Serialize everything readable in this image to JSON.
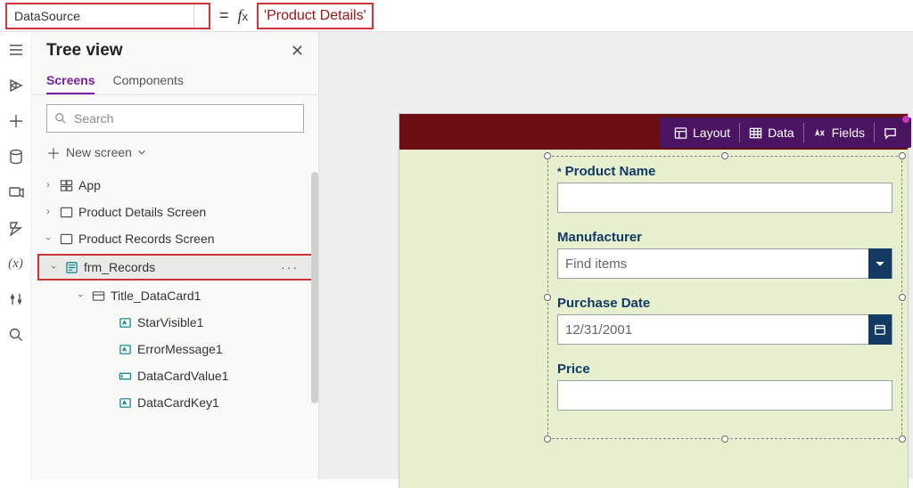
{
  "formula": {
    "property": "DataSource",
    "expression": "'Product Details'"
  },
  "treeview": {
    "title": "Tree view",
    "tabs": {
      "screens": "Screens",
      "components": "Components"
    },
    "search_placeholder": "Search",
    "new_screen": "New screen",
    "items": {
      "app": "App",
      "screen_details": "Product Details Screen",
      "screen_records": "Product Records Screen",
      "frm_records": "frm_Records",
      "title_datacard": "Title_DataCard1",
      "star_visible": "StarVisible1",
      "error_message": "ErrorMessage1",
      "datacard_value": "DataCardValue1",
      "datacard_key": "DataCardKey1"
    }
  },
  "toolbar": {
    "layout": "Layout",
    "data": "Data",
    "fields": "Fields"
  },
  "form": {
    "product_name_label": "Product Name",
    "manufacturer_label": "Manufacturer",
    "manufacturer_placeholder": "Find items",
    "purchase_date_label": "Purchase Date",
    "purchase_date_value": "12/31/2001",
    "price_label": "Price"
  }
}
